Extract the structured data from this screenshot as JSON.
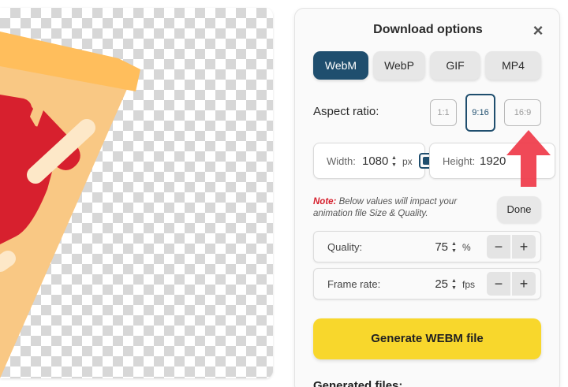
{
  "panel": {
    "title": "Download options",
    "close_icon": "close-icon"
  },
  "formats": [
    {
      "label": "WebM",
      "active": true
    },
    {
      "label": "WebP",
      "active": false
    },
    {
      "label": "GIF",
      "active": false
    },
    {
      "label": "MP4",
      "active": false
    }
  ],
  "aspect": {
    "label": "Aspect ratio:",
    "options": [
      "1:1",
      "9:16",
      "16:9"
    ],
    "selected": "9:16"
  },
  "dimensions": {
    "width_label": "Width:",
    "width_value": "1080",
    "width_unit": "px",
    "height_label": "Height:",
    "height_value": "1920"
  },
  "note": {
    "prefix": "Note:",
    "text": "Below values will impact your animation file Size & Quality."
  },
  "done_label": "Done",
  "quality": {
    "label": "Quality:",
    "value": "75",
    "unit": "%"
  },
  "frame_rate": {
    "label": "Frame rate:",
    "value": "25",
    "unit": "fps"
  },
  "steppers": {
    "minus": "−",
    "plus": "+",
    "up": "▲",
    "down": "▼"
  },
  "generate_label": "Generate WEBM file",
  "generated_files_label": "Generated files:",
  "colors": {
    "accent": "#1f4e6e",
    "generate": "#f8d72c",
    "note": "#d6202d",
    "arrow": "#ef3f4e",
    "pizza_crust": "#ffbe5c",
    "pizza_cheese": "#f9c884",
    "sauce": "#d7202e",
    "cheese_strip": "#fde8c8"
  }
}
